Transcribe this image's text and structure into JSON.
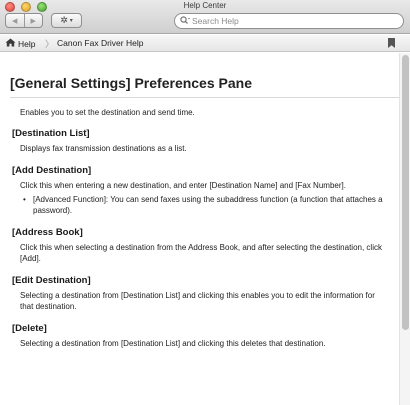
{
  "window": {
    "title": "Help Center"
  },
  "toolbar": {
    "back_icon": "◀",
    "forward_icon": "▶",
    "action_icon": "✲",
    "action_caret": "▾"
  },
  "search": {
    "placeholder": "Search Help",
    "value": ""
  },
  "breadcrumb": {
    "home_label": "Help",
    "current_label": "Canon Fax Driver Help"
  },
  "page": {
    "title": "[General Settings] Preferences Pane",
    "intro": "Enables you to set the destination and send time.",
    "sections": [
      {
        "heading": "[Destination List]",
        "text": "Displays fax transmission destinations as a list."
      },
      {
        "heading": "[Add Destination]",
        "text": "Click this when entering a new destination, and enter [Destination Name] and [Fax Number].",
        "bullets": [
          "[Advanced Function]: You can send faxes using the subaddress function (a function that attaches a password)."
        ]
      },
      {
        "heading": "[Address Book]",
        "text": "Click this when selecting a destination from the Address Book, and after selecting the destination, click [Add]."
      },
      {
        "heading": "[Edit Destination]",
        "text": "Selecting a destination from [Destination List] and clicking this enables you to edit the information for that destination."
      },
      {
        "heading": "[Delete]",
        "text": "Selecting a destination from [Destination List] and clicking this deletes that destination."
      }
    ]
  }
}
